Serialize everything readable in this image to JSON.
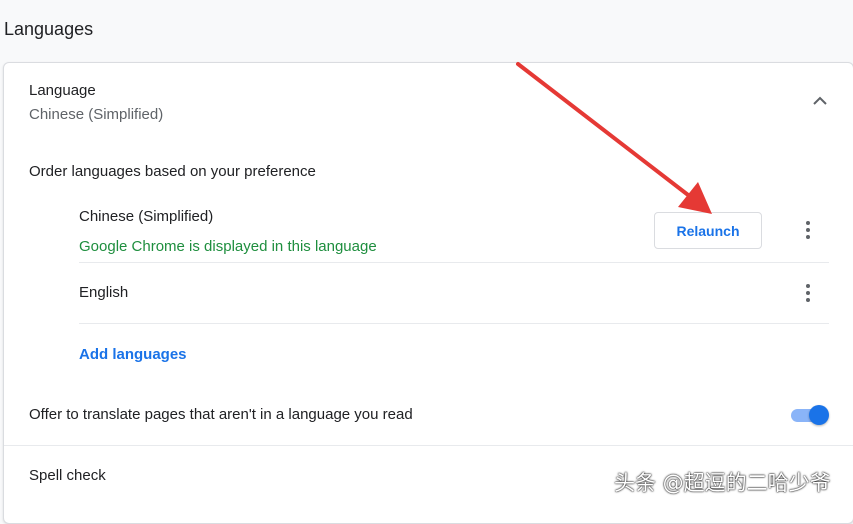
{
  "section": {
    "title": "Languages"
  },
  "language_setting": {
    "label": "Language",
    "value": "Chinese (Simplified)"
  },
  "order": {
    "label": "Order languages based on your preference",
    "languages": [
      {
        "name": "Chinese (Simplified)",
        "note": "Google Chrome is displayed in this language",
        "button": "Relaunch"
      },
      {
        "name": "English"
      }
    ],
    "add_label": "Add languages"
  },
  "translate": {
    "label": "Offer to translate pages that aren't in a language you read",
    "enabled": true
  },
  "spell_check": {
    "label": "Spell check"
  },
  "watermark": "头条 @超逗的二哈少爷",
  "colors": {
    "accent": "#1a73e8",
    "success_text": "#1e8e3e",
    "annotation_arrow": "#e53935"
  },
  "icons": {
    "collapse": "chevron-up-icon",
    "more": "more-vert-icon"
  }
}
